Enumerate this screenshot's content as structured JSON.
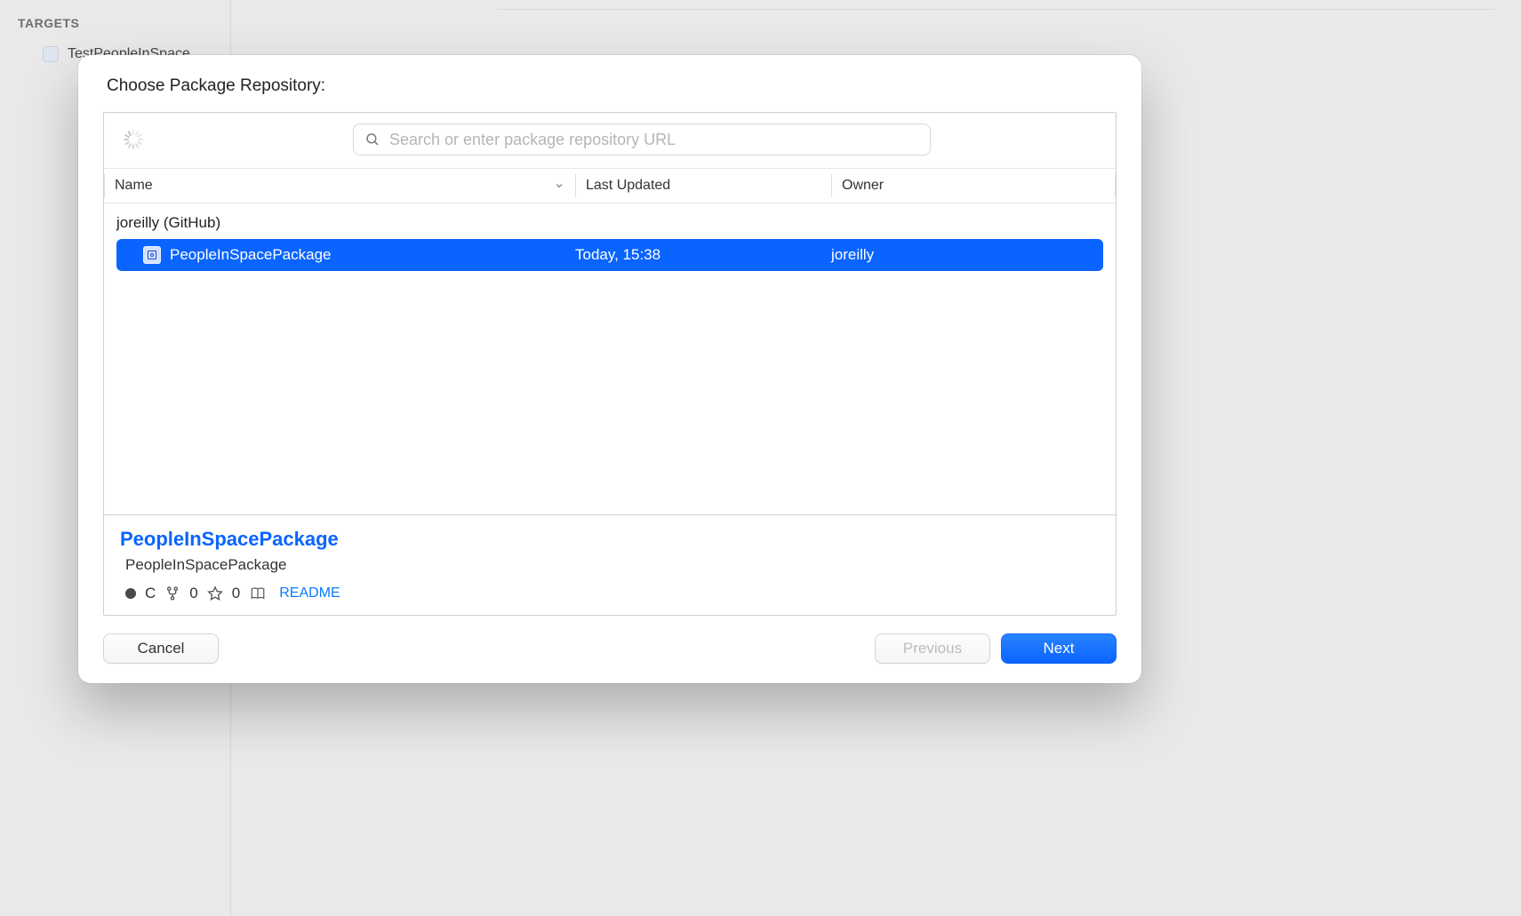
{
  "background": {
    "sidebar": {
      "section_title": "TARGETS",
      "target_name": "TestPeopleInSpace"
    }
  },
  "sheet": {
    "title": "Choose Package Repository:",
    "search": {
      "placeholder": "Search or enter package repository URL",
      "value": ""
    },
    "columns": {
      "name": "Name",
      "last_updated": "Last Updated",
      "owner": "Owner"
    },
    "group_label": "joreilly (GitHub)",
    "rows": [
      {
        "name": "PeopleInSpacePackage",
        "last_updated": "Today, 15:38",
        "owner": "joreilly",
        "selected": true
      }
    ],
    "detail": {
      "title": "PeopleInSpacePackage",
      "subtitle": "PeopleInSpacePackage",
      "language_label": "C",
      "forks": "0",
      "stars": "0",
      "readme_label": "README"
    },
    "buttons": {
      "cancel": "Cancel",
      "previous": "Previous",
      "next": "Next"
    }
  }
}
